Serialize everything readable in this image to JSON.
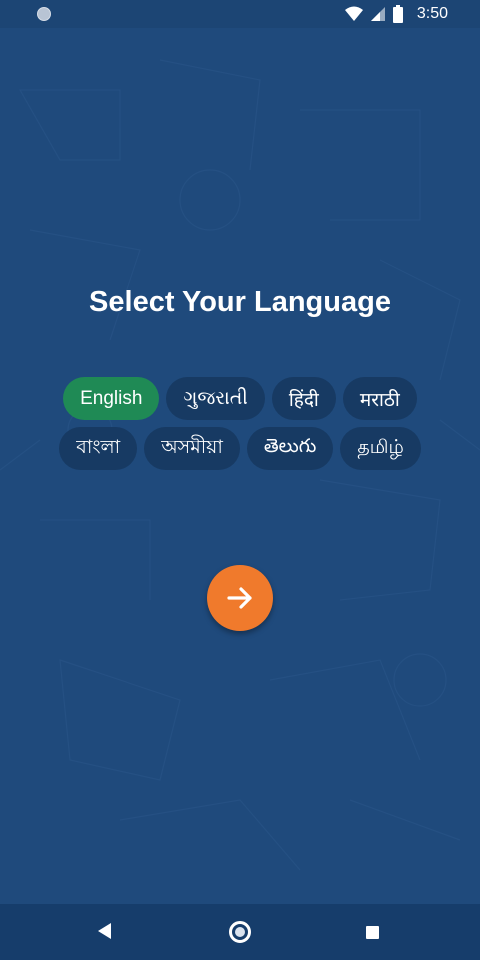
{
  "status_bar": {
    "time": "3:50",
    "icons": [
      "notification-dot-icon",
      "wifi-icon",
      "signal-icon",
      "battery-icon"
    ]
  },
  "title": "Select Your Language",
  "languages": [
    {
      "label": "English",
      "selected": true
    },
    {
      "label": "ગુજરાતી",
      "selected": false
    },
    {
      "label": "हिंदी",
      "selected": false
    },
    {
      "label": "मराठी",
      "selected": false
    },
    {
      "label": "বাংলা",
      "selected": false
    },
    {
      "label": "অসমীয়া",
      "selected": false
    },
    {
      "label": "తెలుగు",
      "selected": false
    },
    {
      "label": "தமிழ்",
      "selected": false
    }
  ],
  "next_button": {
    "icon": "arrow-right-icon"
  },
  "nav_bar": {
    "icons": [
      "back-icon",
      "home-icon",
      "recents-icon"
    ]
  },
  "colors": {
    "background": "#1f4a7c",
    "chip": "#173a63",
    "chip_selected": "#1f8a55",
    "accent": "#f07a2c"
  }
}
